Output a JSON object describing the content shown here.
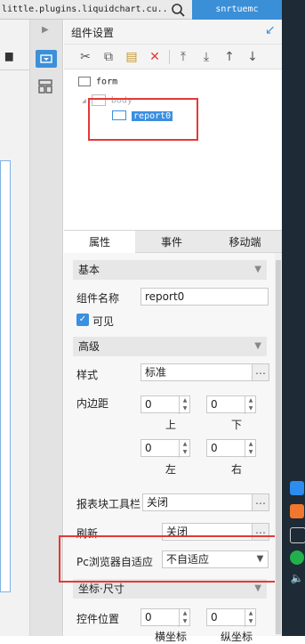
{
  "browser": {
    "url_text": "little.plugins.liquidchart.cu...",
    "tab_title": "snrtuemc"
  },
  "panel": {
    "title": "组件设置"
  },
  "toolbar": {
    "buttons": [
      "cut-icon",
      "copy-icon",
      "paste-icon",
      "delete-icon",
      "move-top-icon",
      "move-bottom-icon",
      "move-up-icon",
      "move-down-icon"
    ]
  },
  "tree": {
    "form": "form",
    "body": "body",
    "report": "report0"
  },
  "tabs": [
    "属性",
    "事件",
    "移动端"
  ],
  "props": {
    "basic_section": "基本",
    "component_name_label": "组件名称",
    "component_name_value": "report0",
    "visible_label": "可见",
    "advanced_section": "高级",
    "style_label": "样式",
    "style_value": "标准",
    "padding_label": "内边距",
    "padding_top": "0",
    "padding_bottom": "0",
    "padding_left": "0",
    "padding_right": "0",
    "top_label": "上",
    "bottom_label": "下",
    "left_label": "左",
    "right_label": "右",
    "report_toolbar_label": "报表块工具栏",
    "report_toolbar_value": "关闭",
    "refresh_label": "刷新",
    "refresh_value": "关闭",
    "pc_adapt_label": "Pc浏览器自适应",
    "pc_adapt_value": "不自适应",
    "coord_section": "坐标·尺寸",
    "position_label": "控件位置",
    "pos_x": "0",
    "pos_y": "0",
    "x_label": "横坐标",
    "y_label": "纵坐标"
  },
  "colors": {
    "accent": "#3b8fe0",
    "highlight_box": "#e53935"
  }
}
